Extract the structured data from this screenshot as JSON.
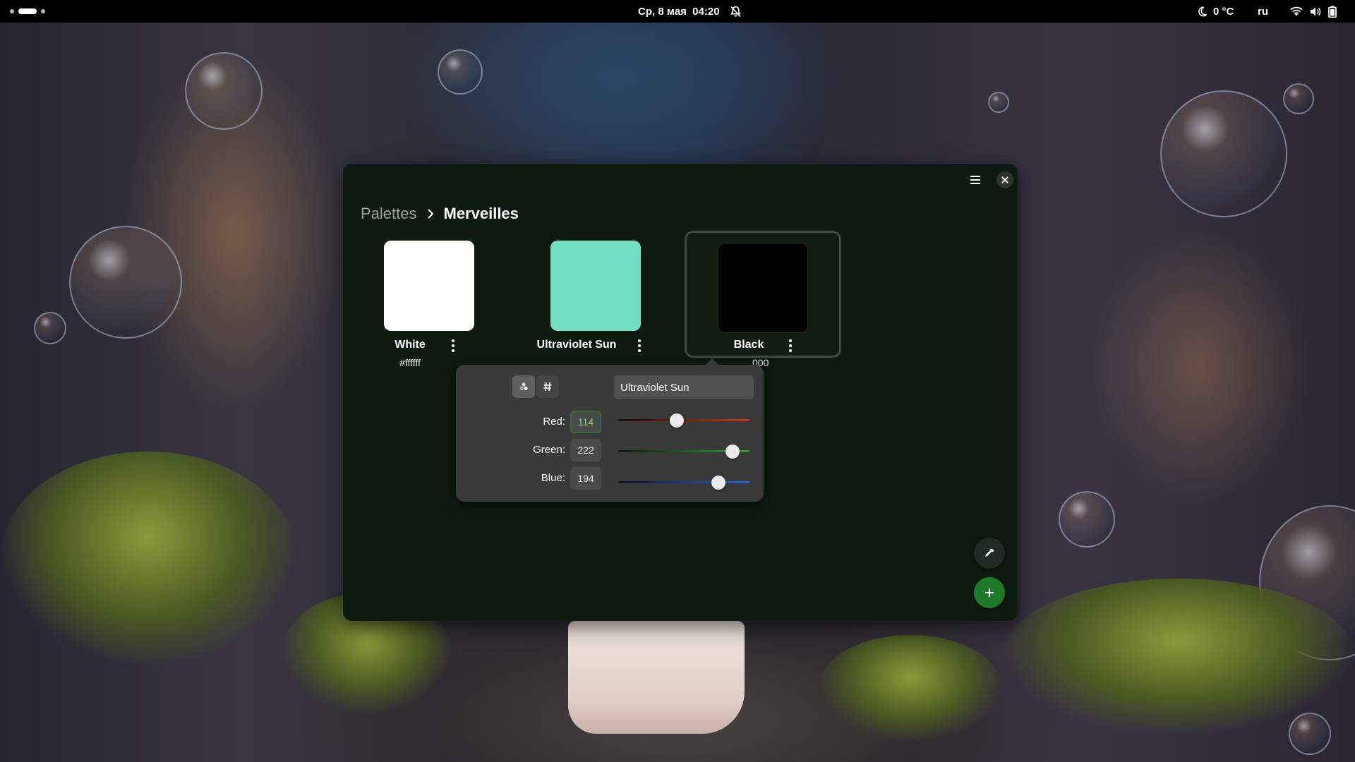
{
  "topbar": {
    "datetime": "Ср, 8 мая  04:20",
    "weather": "0 °C",
    "keyboard_layout": "ru",
    "icons": [
      "notifications-off-icon",
      "night-mode-icon",
      "wifi-icon",
      "volume-icon",
      "battery-icon"
    ]
  },
  "window": {
    "breadcrumb": {
      "root": "Palettes",
      "separator_icon": "chevron-right-icon",
      "current": "Merveilles"
    },
    "header_icons": [
      "hamburger-menu-icon",
      "close-icon"
    ]
  },
  "palette": {
    "colors": [
      {
        "name": "White",
        "hex": "#ffffff",
        "swatch": "#ffffff"
      },
      {
        "name": "Ultraviolet Sun",
        "hex": "",
        "swatch": "#72dec2"
      },
      {
        "name": "Black",
        "hex": "000",
        "swatch": "#000000"
      }
    ],
    "selected_index": 2
  },
  "editor": {
    "mode_icons": [
      "color-wheel-icon",
      "hash-icon"
    ],
    "name_value": "Ultraviolet Sun",
    "channels": [
      {
        "label": "Red:",
        "value": "114",
        "fraction": 0.447,
        "track": "linear-gradient(90deg,#200a04,#c0391a)"
      },
      {
        "label": "Green:",
        "value": "222",
        "fraction": 0.871,
        "track": "linear-gradient(90deg,#111a11,#2f9b36)"
      },
      {
        "label": "Blue:",
        "value": "194",
        "fraction": 0.761,
        "track": "linear-gradient(90deg,#0d1020,#2f62d4)"
      }
    ]
  },
  "actions": {
    "pick_icon": "color-picker-icon",
    "add_icon": "plus-icon"
  },
  "colors": {
    "accent": "#26a269",
    "window_bg": "#0c1a10",
    "popover_bg": "#3a3a3a"
  }
}
